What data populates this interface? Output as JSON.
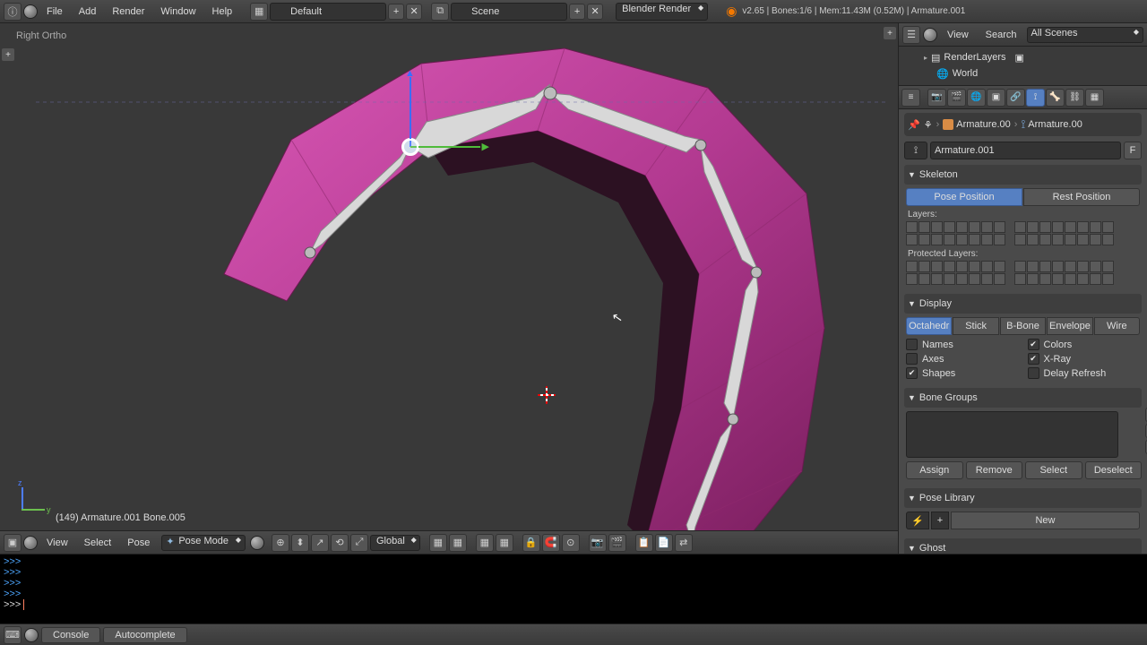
{
  "top": {
    "menus": [
      "File",
      "Add",
      "Render",
      "Window",
      "Help"
    ],
    "layout": "Default",
    "scene": "Scene",
    "engine": "Blender Render",
    "stats": "v2.65 | Bones:1/6 | Mem:11.43M (0.52M) | Armature.001"
  },
  "viewport": {
    "projection": "Right Ortho",
    "selection": "(149) Armature.001 Bone.005",
    "footer": {
      "menus": [
        "View",
        "Select",
        "Pose"
      ],
      "mode": "Pose Mode",
      "orientation": "Global"
    }
  },
  "outliner": {
    "menus": [
      "View",
      "Search"
    ],
    "filter": "All Scenes",
    "items": [
      {
        "name": "RenderLayers",
        "icon": "layers"
      },
      {
        "name": "World",
        "icon": "world"
      }
    ]
  },
  "properties": {
    "breadcrumb": {
      "object": "Armature.00",
      "data": "Armature.00"
    },
    "name": "Armature.001",
    "panels": {
      "skeleton": {
        "title": "Skeleton",
        "pose_btn": "Pose Position",
        "rest_btn": "Rest Position",
        "layers_label": "Layers:",
        "protected_label": "Protected Layers:"
      },
      "display": {
        "title": "Display",
        "shapes": [
          "Octahedr",
          "Stick",
          "B-Bone",
          "Envelope",
          "Wire"
        ],
        "checks": {
          "names": "Names",
          "colors": "Colors",
          "axes": "Axes",
          "xray": "X-Ray",
          "shapes": "Shapes",
          "delay": "Delay Refresh"
        }
      },
      "bone_groups": {
        "title": "Bone Groups",
        "assign": "Assign",
        "remove": "Remove",
        "select": "Select",
        "deselect": "Deselect"
      },
      "pose_library": {
        "title": "Pose Library",
        "new": "New"
      },
      "ghost": {
        "title": "Ghost"
      }
    }
  },
  "console": {
    "prompt": ">>>",
    "footer": {
      "console_btn": "Console",
      "autocomplete_btn": "Autocomplete"
    }
  }
}
